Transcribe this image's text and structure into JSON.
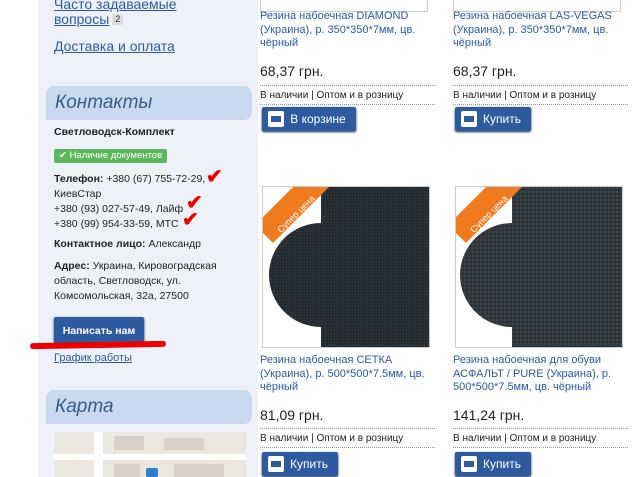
{
  "sidebar": {
    "faq_link_line1": "Часто задаваемые",
    "faq_link_line2": "вопросы",
    "faq_badge": "2",
    "delivery_link": "Доставка и оплата",
    "contacts_title": "Контакты",
    "company_name": "Светловодск-Комплект",
    "documents_badge": "✔ Наличие документов",
    "phone_label": "Телефон:",
    "phone_1": "+380 (67) 755-72-29, КиевСтар",
    "phone_2": "+380 (93) 027-57-49, Лайф",
    "phone_3": "+380 (99) 954-33-59, МТС",
    "contact_label": "Контактное лицо:",
    "contact_name": "Александр",
    "address_label": "Адрес:",
    "address_line1": "Украина, Кировоградская",
    "address_line2": "область, Светловодск, ул.",
    "address_line3": "Комсомольская, 32а, 27500",
    "write_button": "Написать нам",
    "schedule_link": "График работы",
    "map_title": "Карта"
  },
  "products": [
    {
      "title": "Резина набоечная DIAMOND (Украина), р. 350*350*7мм, цв. чёрный",
      "price": "68,37 грн.",
      "in_stock": "В наличии",
      "sale_type": "Оптом и в розницу",
      "button": "В корзине"
    },
    {
      "title": "Резина набоечная LAS-VEGAS (Украина), р. 350*350*7мм, цв. чёрный",
      "price": "68,37 грн.",
      "in_stock": "В наличии",
      "sale_type": "Оптом и в розницу",
      "button": "Купить"
    },
    {
      "title": "Резина набоечная СЕТКА (Украина), р. 500*500*7.5мм, цв. чёрный",
      "price": "81,09 грн.",
      "in_stock": "В наличии",
      "sale_type": "Оптом и в розницу",
      "button": "Купить",
      "ribbon": "Супер цена"
    },
    {
      "title": "Резина набоечная для обуви АСФАЛЬТ / PURE (Украина), р. 500*500*7.5мм, цв. чёрный",
      "price": "141,24 грн.",
      "in_stock": "В наличии",
      "sale_type": "Оптом и в розницу",
      "button": "Купить",
      "ribbon": "Супер цена"
    }
  ],
  "colors": {
    "accent": "#2e5aa0",
    "link": "#2a5aa8",
    "ribbon": "#f07a1e",
    "annotation": "#e00000"
  }
}
